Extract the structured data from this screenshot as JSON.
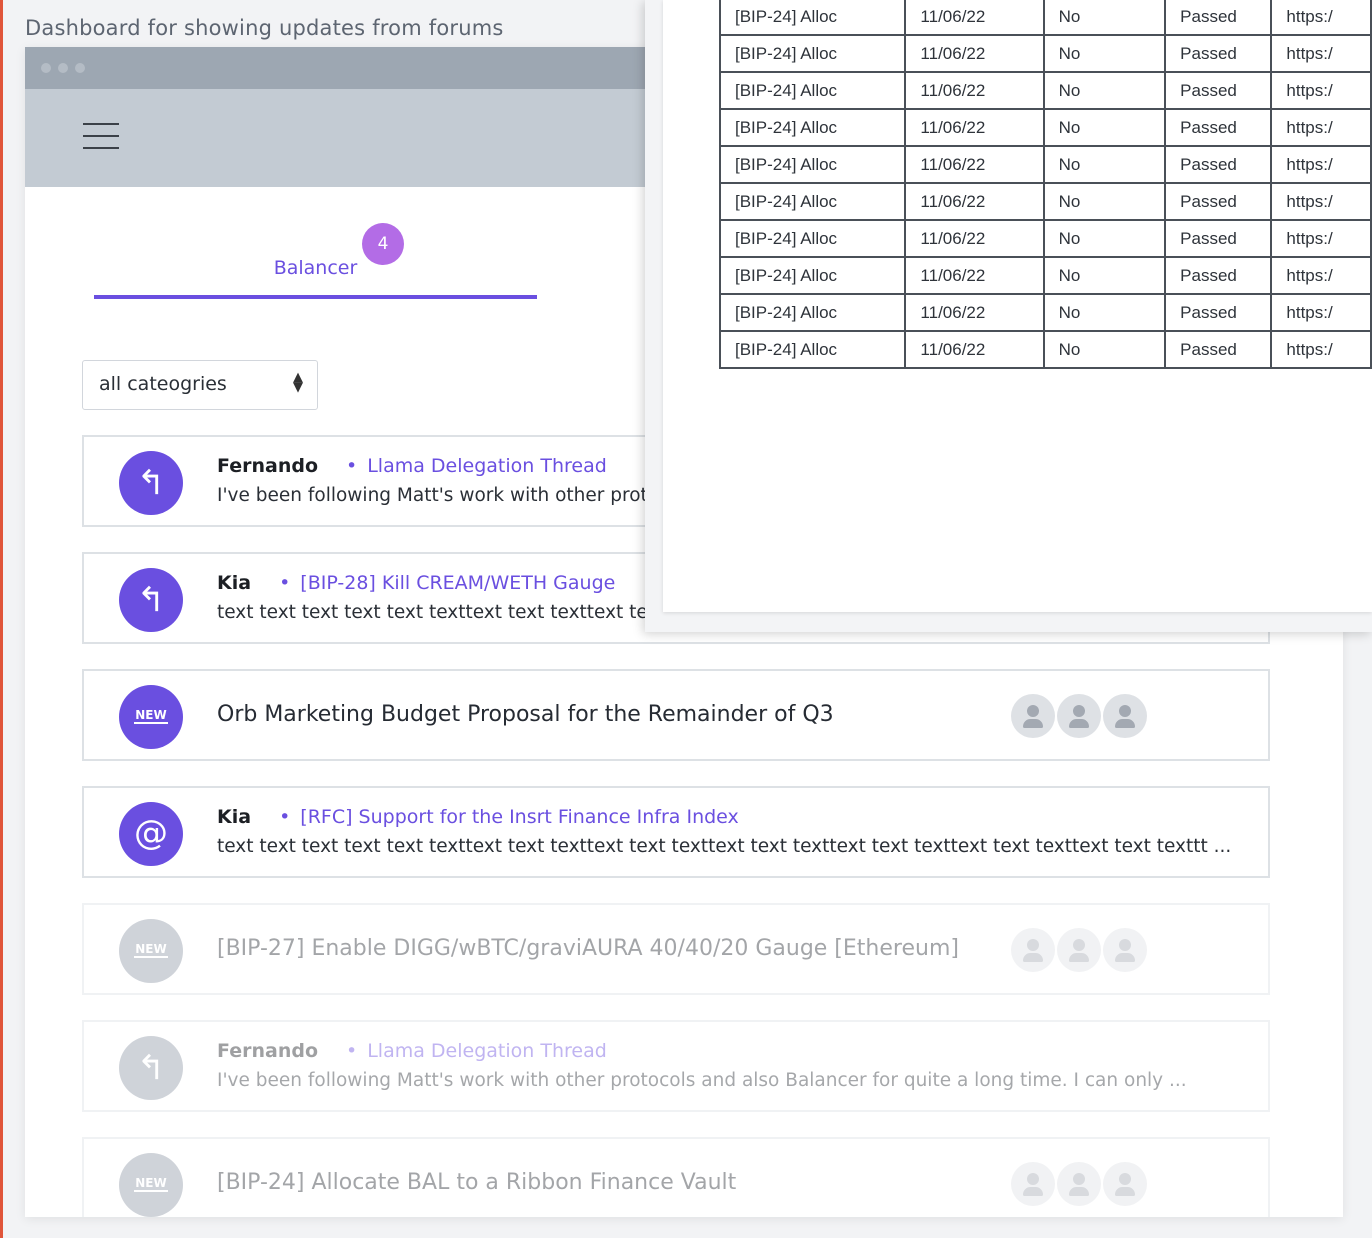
{
  "caption": "Dashboard for showing updates from forums",
  "tabs": [
    {
      "label": "Balancer",
      "badge": "4"
    }
  ],
  "category_filter": {
    "value": "all cateogries"
  },
  "feed": [
    {
      "kind": "reply",
      "author": "Fernando",
      "thread": "Llama Delegation Thread",
      "excerpt": "I've been following Matt's work with other protocols and also Balancer for quite a long time. I can only ..."
    },
    {
      "kind": "reply",
      "author": "Kia",
      "thread": "[BIP-28] Kill CREAM/WETH Gauge",
      "excerpt": "text text text text text texttext text texttext text texttext text texttext text texttext text texttext text texttt ..."
    },
    {
      "kind": "new",
      "title": "Orb Marketing Budget Proposal for the Remainder of Q3",
      "new_label": "NEW"
    },
    {
      "kind": "mention",
      "author": "Kia",
      "thread": "[RFC] Support for the Insrt Finance Infra Index",
      "excerpt": "text text text text text texttext text texttext text texttext text texttext text texttext text texttext text texttt ..."
    },
    {
      "kind": "new",
      "title": "[BIP-27] Enable DIGG/wBTC/graviAURA 40/40/20 Gauge [Ethereum]",
      "new_label": "NEW"
    },
    {
      "kind": "reply",
      "author": "Fernando",
      "thread": "Llama Delegation Thread",
      "excerpt": "I've been following Matt's work with other protocols and also Balancer for quite a long time. I can only ..."
    },
    {
      "kind": "new",
      "title": "[BIP-24] Allocate BAL to a Ribbon Finance Vault",
      "new_label": "NEW"
    }
  ],
  "table": {
    "rows": [
      [
        "[BIP-24] Alloc",
        "11/06/22",
        "No",
        "Passed",
        "https:/"
      ],
      [
        "[BIP-24] Alloc",
        "11/06/22",
        "No",
        "Passed",
        "https:/"
      ],
      [
        "[BIP-24] Alloc",
        "11/06/22",
        "No",
        "Passed",
        "https:/"
      ],
      [
        "[BIP-24] Alloc",
        "11/06/22",
        "No",
        "Passed",
        "https:/"
      ],
      [
        "[BIP-24] Alloc",
        "11/06/22",
        "No",
        "Passed",
        "https:/"
      ],
      [
        "[BIP-24] Alloc",
        "11/06/22",
        "No",
        "Passed",
        "https:/"
      ],
      [
        "[BIP-24] Alloc",
        "11/06/22",
        "No",
        "Passed",
        "https:/"
      ],
      [
        "[BIP-24] Alloc",
        "11/06/22",
        "No",
        "Passed",
        "https:/"
      ],
      [
        "[BIP-24] Alloc",
        "11/06/22",
        "No",
        "Passed",
        "https:/"
      ],
      [
        "[BIP-24] Alloc",
        "11/06/22",
        "No",
        "Passed",
        "https:/"
      ]
    ]
  },
  "colors": {
    "accent": "#6a4fe0",
    "badge": "#b36ce6",
    "appbar": "#c3cbd3",
    "titlebar": "#9da7b2"
  }
}
